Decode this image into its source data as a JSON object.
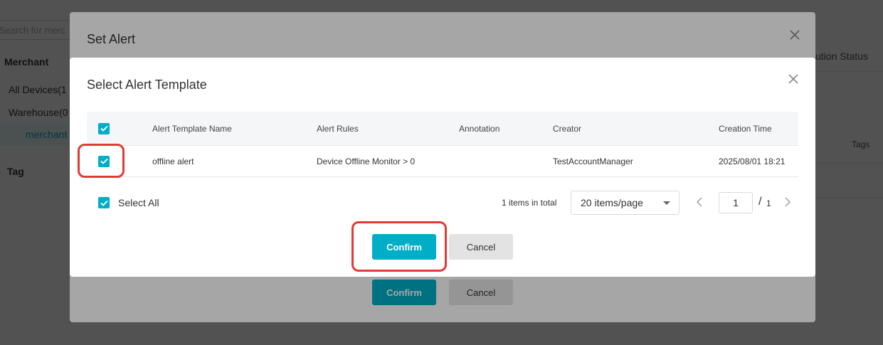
{
  "background": {
    "search_placeholder": "Search for merc",
    "tree_head": "Merchant",
    "tree_items": [
      "All Devices(1",
      "Warehouse(0",
      "merchant"
    ],
    "tag_head": "Tag",
    "col_status": "ution Status",
    "col_tags": "Tags"
  },
  "outer_dialog": {
    "title": "Set Alert",
    "close_icon": "close-icon",
    "confirm_label": "Confirm",
    "cancel_label": "Cancel"
  },
  "dialog": {
    "title": "Select Alert Template",
    "close_icon": "close-icon",
    "columns": [
      "Alert Template Name",
      "Alert Rules",
      "Annotation",
      "Creator",
      "Creation Time"
    ],
    "rows": [
      {
        "checked": true,
        "name": "offline alert",
        "rules": "Device Offline Monitor > 0",
        "annotation": "",
        "creator": "TestAccountManager",
        "created": "2025/08/01 18:21"
      }
    ],
    "header_checked": true,
    "select_all_label": "Select All",
    "select_all_checked": true,
    "total_text": "1 items in total",
    "page_size": "20 items/page",
    "current_page": "1",
    "page_separator": "/",
    "total_pages": "1",
    "confirm_label": "Confirm",
    "cancel_label": "Cancel"
  },
  "colors": {
    "accent": "#00aec7",
    "highlight": "#e53935"
  }
}
